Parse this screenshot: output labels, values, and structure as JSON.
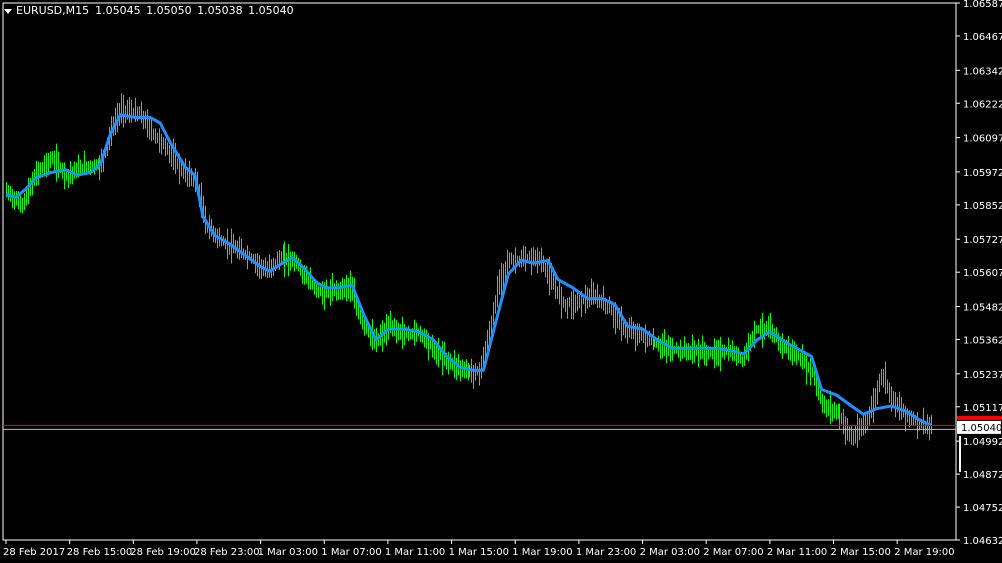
{
  "chart_header": {
    "symbol": "EURUSD,M15",
    "open": "1.05045",
    "high": "1.05050",
    "low": "1.05038",
    "close": "1.05040"
  },
  "colors": {
    "background": "#000000",
    "bars": "#00ff00",
    "moving_average": "#1e90ff",
    "ask_line": "#ff0000",
    "bid_line": "#c0c0c0",
    "axis": "#ffffff"
  },
  "chart_data": {
    "type": "line",
    "chart_style": "ohlc-bars",
    "timeframe": "M15",
    "title": "EURUSD,M15",
    "current_price": 1.0504,
    "current_price_label": "1.05040",
    "ylim": [
      1.04632,
      1.06587
    ],
    "xlim": [
      0,
      930
    ],
    "grid": false,
    "y_ticks": [
      "1.06587",
      "1.06467",
      "1.06342",
      "1.06222",
      "1.06097",
      "1.05972",
      "1.05852",
      "1.05727",
      "1.05607",
      "1.05482",
      "1.05362",
      "1.05237",
      "1.05117",
      "1.04992",
      "1.04872",
      "1.04752",
      "1.04632"
    ],
    "x_tick_labels": [
      {
        "x": 0,
        "label": "28 Feb 2017"
      },
      {
        "x": 64,
        "label": "28 Feb 15:00"
      },
      {
        "x": 128,
        "label": "28 Feb 19:00"
      },
      {
        "x": 192,
        "label": "28 Feb 23:00"
      },
      {
        "x": 256,
        "label": "1 Mar 03:00"
      },
      {
        "x": 320,
        "label": "1 Mar 07:00"
      },
      {
        "x": 384,
        "label": "1 Mar 11:00"
      },
      {
        "x": 448,
        "label": "1 Mar 15:00"
      },
      {
        "x": 512,
        "label": "1 Mar 19:00"
      },
      {
        "x": 576,
        "label": "1 Mar 23:00"
      },
      {
        "x": 640,
        "label": "2 Mar 03:00"
      },
      {
        "x": 704,
        "label": "2 Mar 07:00"
      },
      {
        "x": 768,
        "label": "2 Mar 11:00"
      },
      {
        "x": 832,
        "label": "2 Mar 15:00"
      },
      {
        "x": 896,
        "label": "2 Mar 19:00"
      }
    ],
    "series": [
      {
        "role": "price",
        "points": [
          [
            0,
            1.059
          ],
          [
            15,
            1.0585
          ],
          [
            30,
            1.0597
          ],
          [
            45,
            1.0602
          ],
          [
            60,
            1.0596
          ],
          [
            75,
            1.0599
          ],
          [
            95,
            1.06
          ],
          [
            105,
            1.0612
          ],
          [
            115,
            1.062
          ],
          [
            125,
            1.0619
          ],
          [
            135,
            1.0618
          ],
          [
            145,
            1.0612
          ],
          [
            160,
            1.0606
          ],
          [
            175,
            1.0598
          ],
          [
            190,
            1.0594
          ],
          [
            200,
            1.0578
          ],
          [
            215,
            1.0572
          ],
          [
            230,
            1.0569
          ],
          [
            245,
            1.0566
          ],
          [
            260,
            1.0561
          ],
          [
            275,
            1.0566
          ],
          [
            290,
            1.0565
          ],
          [
            300,
            1.0559
          ],
          [
            315,
            1.0553
          ],
          [
            330,
            1.0554
          ],
          [
            345,
            1.0556
          ],
          [
            355,
            1.0544
          ],
          [
            370,
            1.0535
          ],
          [
            385,
            1.0541
          ],
          [
            400,
            1.0538
          ],
          [
            415,
            1.0539
          ],
          [
            430,
            1.0532
          ],
          [
            445,
            1.0528
          ],
          [
            460,
            1.0525
          ],
          [
            475,
            1.0524
          ],
          [
            485,
            1.0537
          ],
          [
            495,
            1.0557
          ],
          [
            505,
            1.0565
          ],
          [
            520,
            1.0565
          ],
          [
            535,
            1.0566
          ],
          [
            550,
            1.0556
          ],
          [
            560,
            1.0549
          ],
          [
            575,
            1.055
          ],
          [
            590,
            1.0552
          ],
          [
            605,
            1.0548
          ],
          [
            620,
            1.054
          ],
          [
            635,
            1.0538
          ],
          [
            650,
            1.0535
          ],
          [
            665,
            1.0533
          ],
          [
            680,
            1.0532
          ],
          [
            695,
            1.0532
          ],
          [
            710,
            1.0531
          ],
          [
            725,
            1.0532
          ],
          [
            740,
            1.0529
          ],
          [
            752,
            1.054
          ],
          [
            765,
            1.054
          ],
          [
            780,
            1.0534
          ],
          [
            795,
            1.053
          ],
          [
            810,
            1.0524
          ],
          [
            820,
            1.0512
          ],
          [
            835,
            1.051
          ],
          [
            850,
            1.05
          ],
          [
            860,
            1.0504
          ],
          [
            870,
            1.0511
          ],
          [
            880,
            1.0524
          ],
          [
            890,
            1.0515
          ],
          [
            900,
            1.051
          ],
          [
            915,
            1.0506
          ],
          [
            930,
            1.0504
          ]
        ]
      },
      {
        "role": "moving-average",
        "points": [
          [
            0,
            1.0589
          ],
          [
            10,
            1.0588
          ],
          [
            20,
            1.0591
          ],
          [
            30,
            1.0595
          ],
          [
            45,
            1.0597
          ],
          [
            60,
            1.0598
          ],
          [
            72,
            1.0596
          ],
          [
            85,
            1.0597
          ],
          [
            95,
            1.06
          ],
          [
            105,
            1.0611
          ],
          [
            115,
            1.0618
          ],
          [
            130,
            1.0617
          ],
          [
            145,
            1.0617
          ],
          [
            155,
            1.0615
          ],
          [
            165,
            1.0608
          ],
          [
            180,
            1.0599
          ],
          [
            190,
            1.0596
          ],
          [
            198,
            1.0581
          ],
          [
            210,
            1.0574
          ],
          [
            225,
            1.0571
          ],
          [
            240,
            1.0567
          ],
          [
            255,
            1.0563
          ],
          [
            265,
            1.0561
          ],
          [
            278,
            1.0564
          ],
          [
            288,
            1.0566
          ],
          [
            300,
            1.0562
          ],
          [
            312,
            1.0557
          ],
          [
            322,
            1.0555
          ],
          [
            335,
            1.0555
          ],
          [
            348,
            1.0556
          ],
          [
            360,
            1.0545
          ],
          [
            372,
            1.0536
          ],
          [
            385,
            1.054
          ],
          [
            400,
            1.054
          ],
          [
            415,
            1.0539
          ],
          [
            430,
            1.0536
          ],
          [
            443,
            1.053
          ],
          [
            457,
            1.0526
          ],
          [
            470,
            1.0525
          ],
          [
            480,
            1.0525
          ],
          [
            492,
            1.0542
          ],
          [
            505,
            1.056
          ],
          [
            518,
            1.0565
          ],
          [
            530,
            1.0564
          ],
          [
            545,
            1.0565
          ],
          [
            555,
            1.0558
          ],
          [
            570,
            1.0555
          ],
          [
            585,
            1.0551
          ],
          [
            600,
            1.0551
          ],
          [
            612,
            1.0549
          ],
          [
            625,
            1.0541
          ],
          [
            640,
            1.054
          ],
          [
            655,
            1.0536
          ],
          [
            670,
            1.0533
          ],
          [
            685,
            1.0533
          ],
          [
            700,
            1.0533
          ],
          [
            715,
            1.0533
          ],
          [
            730,
            1.0532
          ],
          [
            742,
            1.0531
          ],
          [
            755,
            1.0536
          ],
          [
            768,
            1.0539
          ],
          [
            780,
            1.0536
          ],
          [
            795,
            1.0533
          ],
          [
            810,
            1.053
          ],
          [
            820,
            1.0518
          ],
          [
            835,
            1.0516
          ],
          [
            850,
            1.0512
          ],
          [
            862,
            1.0509
          ],
          [
            875,
            1.0511
          ],
          [
            890,
            1.0512
          ],
          [
            905,
            1.051
          ],
          [
            918,
            1.0507
          ],
          [
            930,
            1.0505
          ]
        ]
      }
    ]
  }
}
